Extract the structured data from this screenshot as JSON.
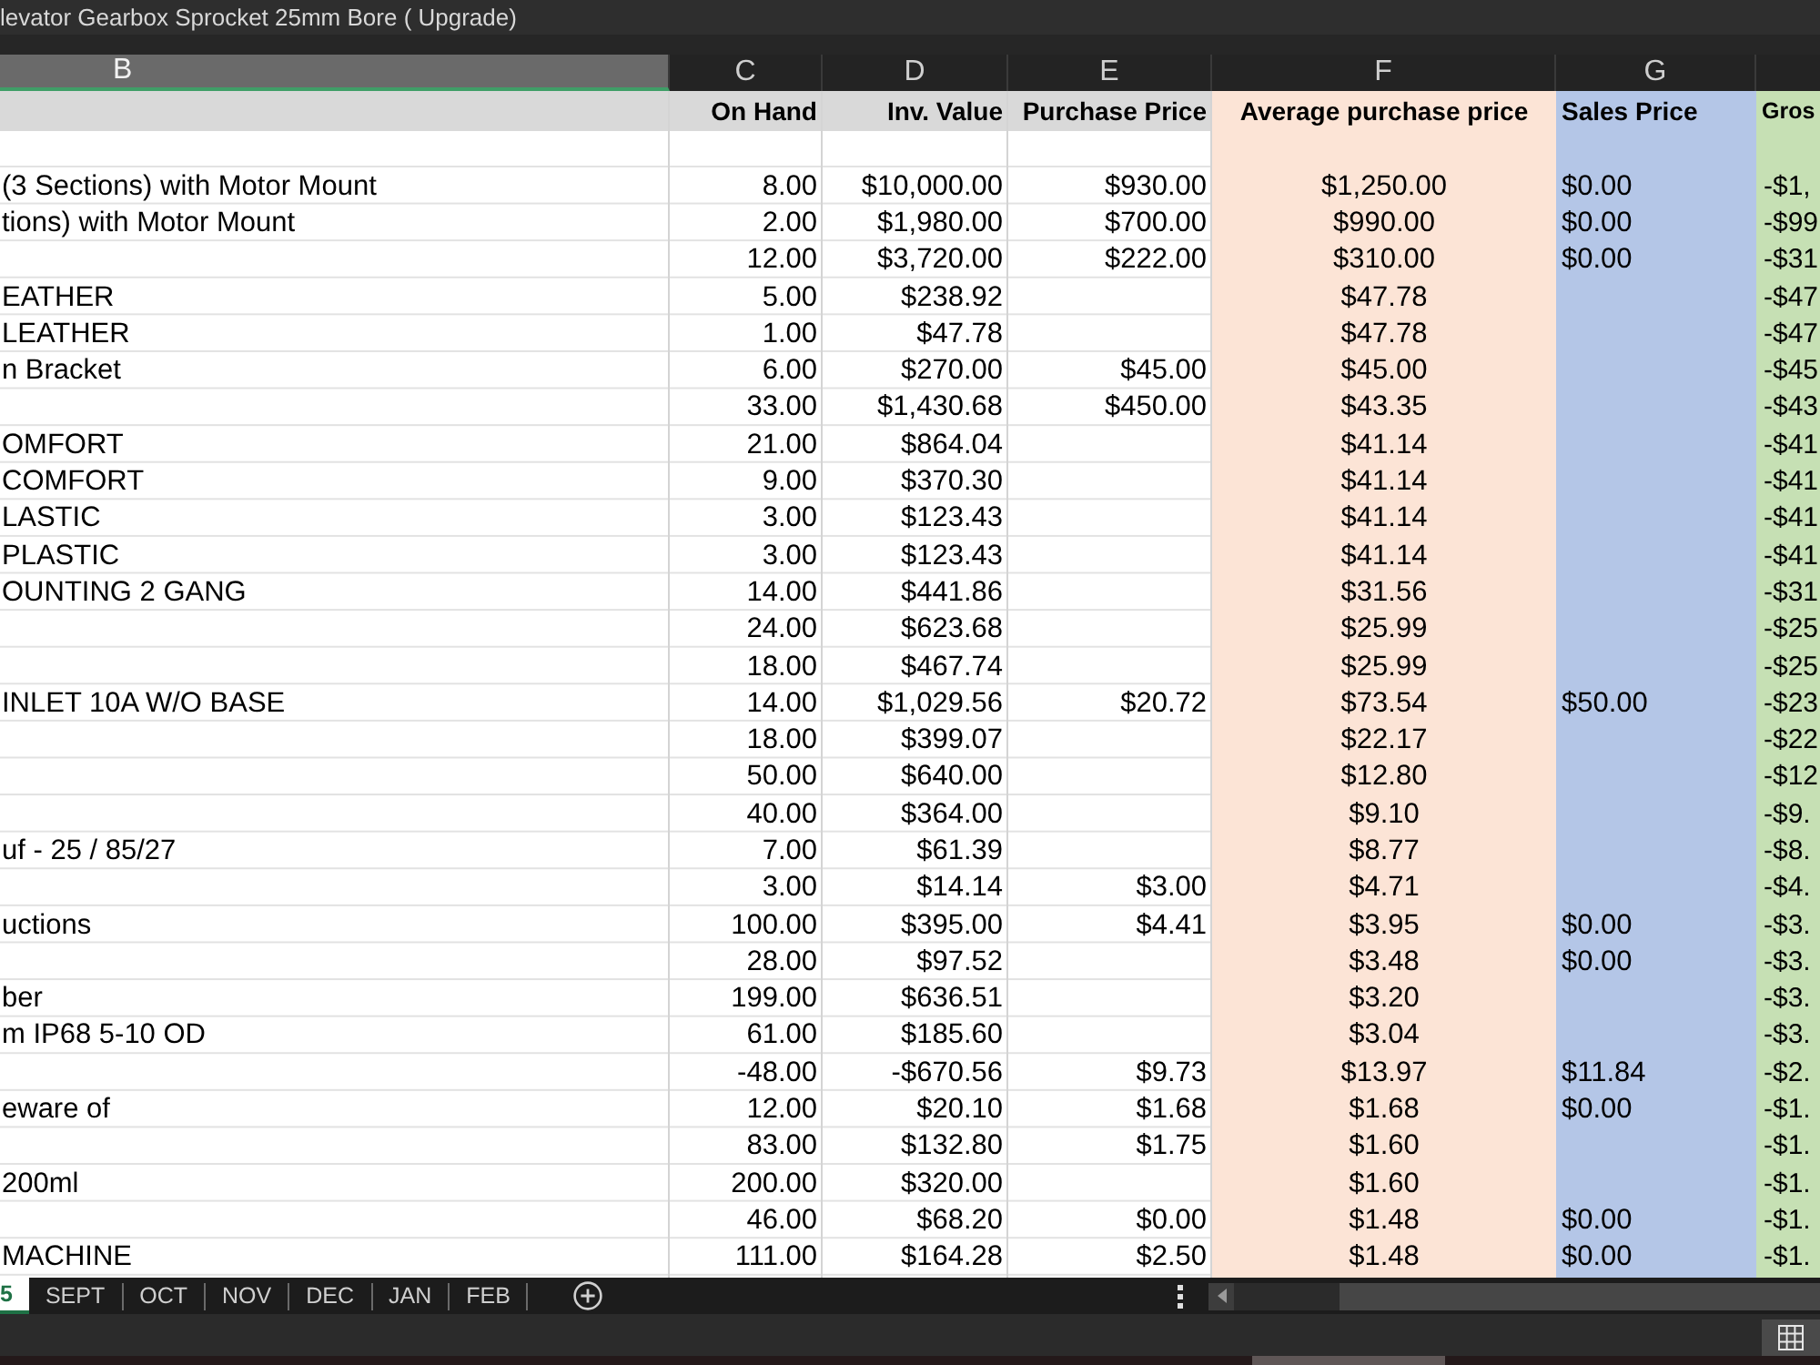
{
  "formula_bar": {
    "value": "levator Gearbox Sprocket 25mm Bore ( Upgrade)"
  },
  "columns": [
    {
      "letter": "B",
      "selected": true
    },
    {
      "letter": "C",
      "selected": false
    },
    {
      "letter": "D",
      "selected": false
    },
    {
      "letter": "E",
      "selected": false
    },
    {
      "letter": "F",
      "selected": false,
      "color": "#fce4d6"
    },
    {
      "letter": "G",
      "selected": false,
      "color": "#b4c6e7"
    },
    {
      "color": "#c6e0b4"
    }
  ],
  "table": {
    "header": {
      "c": "On Hand",
      "d": "Inv. Value",
      "e": "Purchase Price",
      "f": "Average purchase price",
      "g": "Sales Price",
      "h": "Gros"
    },
    "rows": [
      {
        "b": "(3 Sections) with Motor Mount",
        "c": "8.00",
        "d": "$10,000.00",
        "e": "$930.00",
        "f": "$1,250.00",
        "g": "$0.00",
        "h": "-$1,"
      },
      {
        "b": "tions) with Motor Mount",
        "c": "2.00",
        "d": "$1,980.00",
        "e": "$700.00",
        "f": "$990.00",
        "g": "$0.00",
        "h": "-$99"
      },
      {
        "c": "12.00",
        "d": "$3,720.00",
        "e": "$222.00",
        "f": "$310.00",
        "g": "$0.00",
        "h": "-$31"
      },
      {
        "b": "EATHER",
        "c": "5.00",
        "d": "$238.92",
        "f": "$47.78",
        "h": "-$47"
      },
      {
        "b": "LEATHER",
        "c": "1.00",
        "d": "$47.78",
        "f": "$47.78",
        "h": "-$47"
      },
      {
        "b": "n Bracket",
        "c": "6.00",
        "d": "$270.00",
        "e": "$45.00",
        "f": "$45.00",
        "h": "-$45"
      },
      {
        "c": "33.00",
        "d": "$1,430.68",
        "e": "$450.00",
        "f": "$43.35",
        "h": "-$43"
      },
      {
        "b": "OMFORT",
        "c": "21.00",
        "d": "$864.04",
        "f": "$41.14",
        "h": "-$41"
      },
      {
        "b": "COMFORT",
        "c": "9.00",
        "d": "$370.30",
        "f": "$41.14",
        "h": "-$41"
      },
      {
        "b": "LASTIC",
        "c": "3.00",
        "d": "$123.43",
        "f": "$41.14",
        "h": "-$41"
      },
      {
        "b": "PLASTIC",
        "c": "3.00",
        "d": "$123.43",
        "f": "$41.14",
        "h": "-$41"
      },
      {
        "b": "OUNTING 2 GANG",
        "c": "14.00",
        "d": "$441.86",
        "f": "$31.56",
        "h": "-$31"
      },
      {
        "c": "24.00",
        "d": "$623.68",
        "f": "$25.99",
        "h": "-$25"
      },
      {
        "c": "18.00",
        "d": "$467.74",
        "f": "$25.99",
        "h": "-$25"
      },
      {
        "b": "INLET 10A W/O BASE",
        "c": "14.00",
        "d": "$1,029.56",
        "e": "$20.72",
        "f": "$73.54",
        "g": "$50.00",
        "h": "-$23"
      },
      {
        "c": "18.00",
        "d": "$399.07",
        "f": "$22.17",
        "h": "-$22"
      },
      {
        "c": "50.00",
        "d": "$640.00",
        "f": "$12.80",
        "h": "-$12"
      },
      {
        "c": "40.00",
        "d": "$364.00",
        "f": "$9.10",
        "h": "-$9."
      },
      {
        "b": "uf - 25 / 85/27",
        "c": "7.00",
        "d": "$61.39",
        "f": "$8.77",
        "h": "-$8."
      },
      {
        "c": "3.00",
        "d": "$14.14",
        "e": "$3.00",
        "f": "$4.71",
        "h": "-$4."
      },
      {
        "b": "uctions",
        "c": "100.00",
        "d": "$395.00",
        "e": "$4.41",
        "f": "$3.95",
        "g": "$0.00",
        "h": "-$3."
      },
      {
        "c": "28.00",
        "d": "$97.52",
        "f": "$3.48",
        "g": "$0.00",
        "h": "-$3."
      },
      {
        "b": "ber",
        "c": "199.00",
        "d": "$636.51",
        "f": "$3.20",
        "h": "-$3."
      },
      {
        "b": "m IP68 5-10 OD",
        "c": "61.00",
        "d": "$185.60",
        "f": "$3.04",
        "h": "-$3."
      },
      {
        "c": "-48.00",
        "d": "-$670.56",
        "e": "$9.73",
        "f": "$13.97",
        "g": "$11.84",
        "h": "-$2."
      },
      {
        "b": "eware of",
        "c": "12.00",
        "d": "$20.10",
        "e": "$1.68",
        "f": "$1.68",
        "g": "$0.00",
        "h": "-$1."
      },
      {
        "c": "83.00",
        "d": "$132.80",
        "e": "$1.75",
        "f": "$1.60",
        "h": "-$1."
      },
      {
        "b": "200ml",
        "c": "200.00",
        "d": "$320.00",
        "f": "$1.60",
        "h": "-$1."
      },
      {
        "c": "46.00",
        "d": "$68.20",
        "e": "$0.00",
        "f": "$1.48",
        "g": "$0.00",
        "h": "-$1."
      },
      {
        "b": "MACHINE",
        "c": "111.00",
        "d": "$164.28",
        "e": "$2.50",
        "f": "$1.48",
        "g": "$0.00",
        "h": "-$1."
      }
    ]
  },
  "sheet_tabs": [
    {
      "label": "5",
      "selected": true
    },
    {
      "label": "SEPT",
      "selected": false
    },
    {
      "label": "OCT",
      "selected": false
    },
    {
      "label": "NOV",
      "selected": false
    },
    {
      "label": "DEC",
      "selected": false
    },
    {
      "label": "JAN",
      "selected": false
    },
    {
      "label": "FEB",
      "selected": false
    }
  ]
}
